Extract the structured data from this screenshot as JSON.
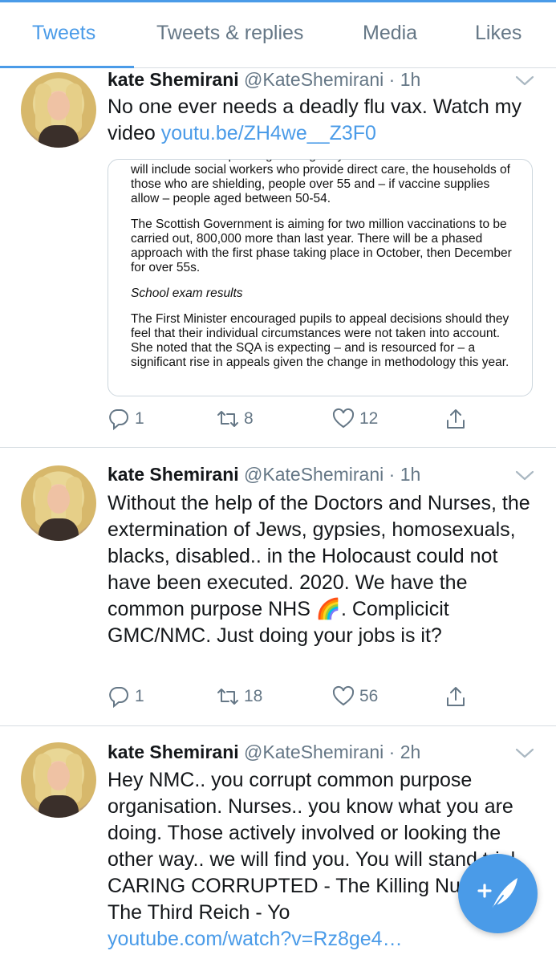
{
  "tabs": [
    {
      "label": "Tweets",
      "active": true
    },
    {
      "label": "Tweets & replies",
      "active": false
    },
    {
      "label": "Media",
      "active": false
    },
    {
      "label": "Likes",
      "active": false
    }
  ],
  "tweets": [
    {
      "name": "kate Shemirani",
      "handle": "@KateShemirani",
      "time": "1h",
      "text": "No one ever needs a deadly flu vax. Watch my video ",
      "link": "youtu.be/ZH4we__Z3F0",
      "card": {
        "p1": "Government is expanding the eligibility criteria for free flu vaccines. It will include social workers who provide direct care, the households of those who are shielding, people over 55 and – if vaccine supplies allow – people aged between 50-54.",
        "p2": "The Scottish Government is aiming for two million vaccinations to be carried out, 800,000 more than last year. There will be a phased approach with the first phase taking place in October, then December for over 55s.",
        "heading": "School exam results",
        "p3": "The First Minister encouraged pupils to appeal decisions should they feel that their individual circumstances were not taken into account. She noted that the SQA is expecting – and is resourced for – a significant rise in appeals given the change in methodology this year."
      },
      "replies": "1",
      "retweets": "8",
      "likes": "12"
    },
    {
      "name": "kate Shemirani",
      "handle": "@KateShemirani",
      "time": "1h",
      "text_a": "Without the help of the Doctors and Nurses, the extermination of Jews, gypsies, homosexuals, blacks, disabled.. in the Holocaust could not have been executed. 2020. We have the common purpose NHS ",
      "emoji": "🌈",
      "text_b": ". Complicicit GMC/NMC. Just doing your jobs is it?",
      "replies": "1",
      "retweets": "18",
      "likes": "56"
    },
    {
      "name": "kate Shemirani",
      "handle": "@KateShemirani",
      "time": "2h",
      "text": "Hey NMC.. you corrupt common purpose organisation. Nurses.. you know what you are doing. Those actively involved or looking the other way.. we will find you. You will stand trial.  CARING CORRUPTED - The Killing Nurses of The Third Reich - Yo",
      "link": "youtube.com/watch?v=Rz8ge4…"
    }
  ],
  "icons": {
    "reply": "reply-icon",
    "retweet": "retweet-icon",
    "like": "heart-icon",
    "share": "share-icon",
    "more": "chevron-down-icon",
    "compose": "compose-tweet-icon"
  },
  "colors": {
    "accent": "#4a9be8",
    "secondary_text": "#657786",
    "divider": "#d7dde2"
  }
}
